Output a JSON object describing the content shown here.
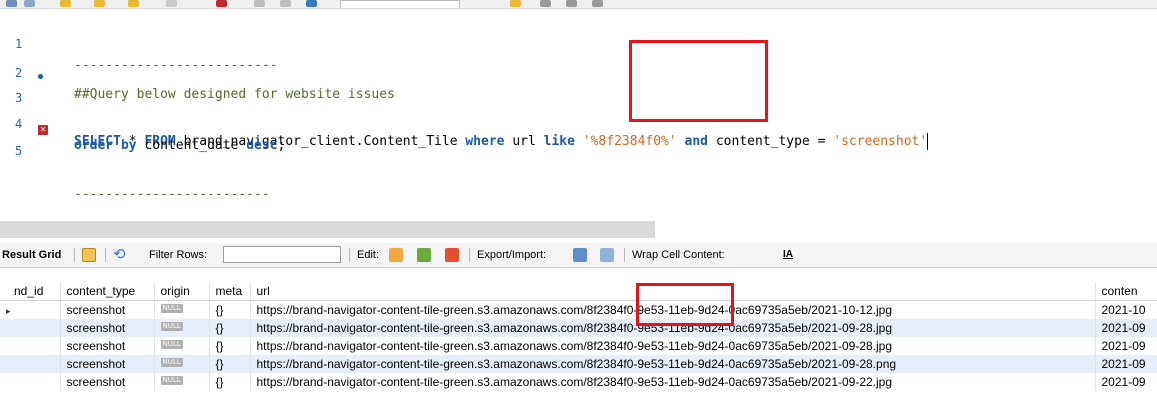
{
  "editor": {
    "lines": [
      {
        "num": "1",
        "marker": "",
        "parts": [
          {
            "cls": "cm",
            "text": "--------------------------"
          }
        ]
      },
      {
        "num": "2",
        "marker": "",
        "parts": [
          {
            "cls": "cm",
            "text": "##Query below designed for website issues"
          }
        ]
      },
      {
        "num": "3",
        "marker": "dot",
        "parts": [
          {
            "cls": "kw",
            "text": "SELECT"
          },
          {
            "cls": "plain",
            "text": " * "
          },
          {
            "cls": "kw",
            "text": "FROM"
          },
          {
            "cls": "plain",
            "text": " brand_navigator_client.Content_Tile "
          },
          {
            "cls": "kw",
            "text": "where"
          },
          {
            "cls": "plain",
            "text": " url "
          },
          {
            "cls": "kw",
            "text": "like"
          },
          {
            "cls": "plain",
            "text": " "
          },
          {
            "cls": "str",
            "text": "'%8f2384f0%'"
          },
          {
            "cls": "plain",
            "text": " "
          },
          {
            "cls": "kw",
            "text": "and"
          },
          {
            "cls": "plain",
            "text": " content_type = "
          },
          {
            "cls": "str",
            "text": "'screenshot'"
          }
        ]
      },
      {
        "num": "4",
        "marker": "",
        "parts": [
          {
            "cls": "kw",
            "text": "order by"
          },
          {
            "cls": "plain",
            "text": " content_date "
          },
          {
            "cls": "kw",
            "text": "desc"
          },
          {
            "cls": "plain",
            "text": ";"
          }
        ]
      },
      {
        "num": "5",
        "marker": "error",
        "parts": [
          {
            "cls": "cm",
            "text": "-------------------------"
          }
        ]
      }
    ]
  },
  "result_toolbar": {
    "result_grid_label": "Result Grid",
    "filter_rows_label": "Filter Rows:",
    "filter_value": "",
    "edit_label": "Edit:",
    "export_label": "Export/Import:",
    "wrap_label": "Wrap Cell Content:"
  },
  "grid": {
    "columns": [
      "nd_id",
      "content_type",
      "origin",
      "meta",
      "url",
      "conten"
    ],
    "rows": [
      {
        "id": "",
        "type": "screenshot",
        "origin": "NULL",
        "meta": "{}",
        "url": "https://brand-navigator-content-tile-green.s3.amazonaws.com/8f2384f0-9e53-11eb-9d24-0ac69735a5eb/2021-10-12.jpg",
        "date": "2021-10"
      },
      {
        "id": "",
        "type": "screenshot",
        "origin": "NULL",
        "meta": "{}",
        "url": "https://brand-navigator-content-tile-green.s3.amazonaws.com/8f2384f0-9e53-11eb-9d24-0ac69735a5eb/2021-09-28.jpg",
        "date": "2021-09"
      },
      {
        "id": "",
        "type": "screenshot",
        "origin": "NULL",
        "meta": "{}",
        "url": "https://brand-navigator-content-tile-green.s3.amazonaws.com/8f2384f0-9e53-11eb-9d24-0ac69735a5eb/2021-09-28.jpg",
        "date": "2021-09"
      },
      {
        "id": "",
        "type": "screenshot",
        "origin": "NULL",
        "meta": "{}",
        "url": "https://brand-navigator-content-tile-green.s3.amazonaws.com/8f2384f0-9e53-11eb-9d24-0ac69735a5eb/2021-09-28.png",
        "date": "2021-09"
      },
      {
        "id": "",
        "type": "screenshot",
        "origin": "NULL",
        "meta": "{}",
        "url": "https://brand-navigator-content-tile-green.s3.amazonaws.com/8f2384f0-9e53-11eb-9d24-0ac69735a5eb/2021-09-22.jpg",
        "date": "2021-09"
      }
    ]
  },
  "colors": {
    "keyword": "#1b5aa6",
    "string": "#d2691e",
    "comment": "#556b2f",
    "highlight_box": "#e3151a",
    "alt_row": "#e7eefb"
  }
}
